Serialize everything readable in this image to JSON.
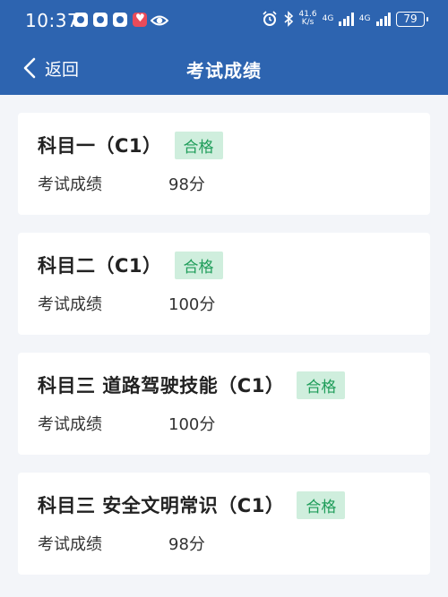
{
  "status_bar": {
    "time": "10:37",
    "net_speed_value": "41.6",
    "net_speed_unit": "K/s",
    "network_1": "4G",
    "network_2": "4G",
    "battery": "79"
  },
  "navbar": {
    "back_label": "返回",
    "title": "考试成绩"
  },
  "results": [
    {
      "subject": "科目一（C1）",
      "status": "合格",
      "score_label": "考试成绩",
      "score": "98分"
    },
    {
      "subject": "科目二（C1）",
      "status": "合格",
      "score_label": "考试成绩",
      "score": "100分"
    },
    {
      "subject": "科目三 道路驾驶技能（C1）",
      "status": "合格",
      "score_label": "考试成绩",
      "score": "100分"
    },
    {
      "subject": "科目三 安全文明常识（C1）",
      "status": "合格",
      "score_label": "考试成绩",
      "score": "98分"
    }
  ],
  "colors": {
    "header_bg": "#2d64b0",
    "badge_bg": "#cfeedd",
    "badge_text": "#1f9d5a",
    "page_bg": "#f3f5f9"
  }
}
